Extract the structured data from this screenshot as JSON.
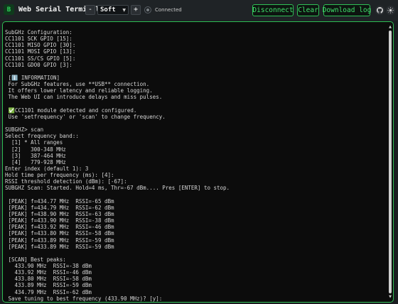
{
  "header": {
    "logo_letter": "B",
    "title": "Web Serial Terminal",
    "mode_decrement": "-",
    "mode_value": "Soft",
    "mode_increment": "+",
    "status": "Connected",
    "disconnect_label": "Disconnect",
    "clear_label": "Clear",
    "download_label": "Download log"
  },
  "colors": {
    "accent": "#2fbf55",
    "background": "#1a1d20",
    "terminal_bg": "#0c0c0c"
  },
  "icons": [
    "status-icon",
    "github-icon",
    "theme-icon"
  ],
  "terminal": {
    "lines": [
      "SubGHz Configuration:",
      "CC1101 SCK GPIO [15]:",
      "CC1101 MISO GPIO [30]:",
      "CC1101 MOSI GPIO [13]:",
      "CC1101 SS/CS GPIO [5]:",
      "CC1101 GDO0 GPIO [3]:",
      "",
      " [ℹ️ INFORMATION]",
      " For SubGHz features, use **USB** connection.",
      " It offers lower latency and reliable logging.",
      " The Web UI can introduce delays and miss pulses.",
      "",
      " ✅CC1101 module detected and configured.",
      " Use 'setfrequency' or 'scan' to change frequency.",
      "",
      "SUBGHZ> scan",
      "Select frequency band::",
      "  [1] * All ranges",
      "  [2]   300-348 MHz",
      "  [3]   387-464 MHz",
      "  [4]   779-928 MHz",
      "Enter index (default 1): 3",
      "Hold time per frequency (ms): [4]:",
      "RSSI threshold detection (dBm): [-67]:",
      "SUBGHZ Scan: Started. Hold=4 ms, Thr=-67 dBm.... Pres [ENTER] to stop.",
      "",
      " [PEAK] f=434.77 MHz  RSSI=-65 dBm",
      " [PEAK] f=434.79 MHz  RSSI=-62 dBm",
      " [PEAK] f=438.90 MHz  RSSI=-63 dBm",
      " [PEAK] f=433.90 MHz  RSSI=-38 dBm",
      " [PEAK] f=433.92 MHz  RSSI=-46 dBm",
      " [PEAK] f=433.80 MHz  RSSI=-58 dBm",
      " [PEAK] f=433.89 MHz  RSSI=-59 dBm",
      " [PEAK] f=433.89 MHz  RSSI=-59 dBm",
      "",
      " [SCAN] Best peaks:",
      "   433.90 MHz  RSSI=-38 dBm",
      "   433.92 MHz  RSSI=-46 dBm",
      "   433.80 MHz  RSSI=-58 dBm",
      "   433.89 MHz  RSSI=-59 dBm",
      "   434.79 MHz  RSSI=-62 dBm",
      " Save tuning to best frequency (433.90 MHz)? [y]:"
    ]
  }
}
